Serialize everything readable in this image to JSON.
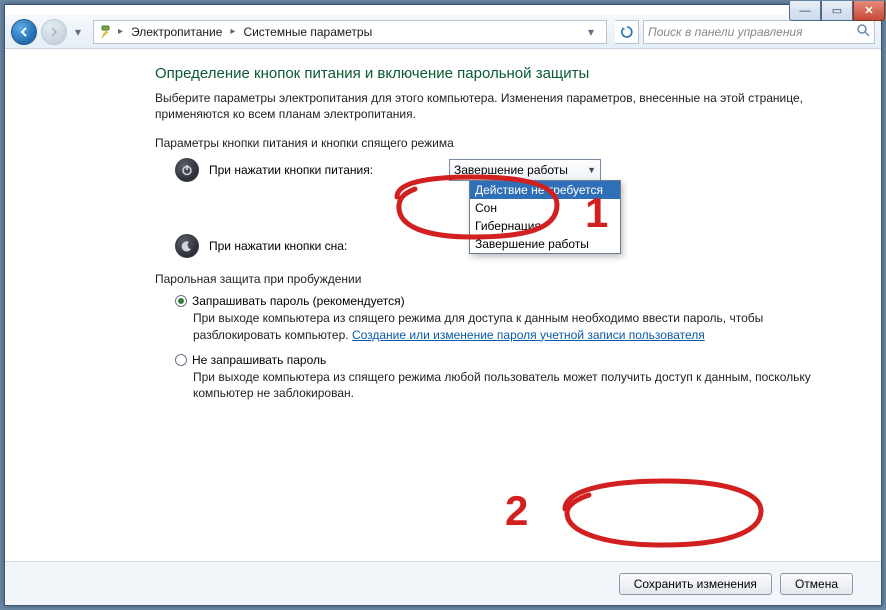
{
  "window": {
    "min_glyph": "—",
    "max_glyph": "▭",
    "close_glyph": "✕"
  },
  "nav": {
    "breadcrumb": {
      "seg1": "Электропитание",
      "seg2": "Системные параметры"
    },
    "search_placeholder": "Поиск в панели управления"
  },
  "page": {
    "heading": "Определение кнопок питания и включение парольной защиты",
    "intro": "Выберите параметры электропитания для этого компьютера. Изменения параметров, внесенные на этой странице, применяются ко всем планам электропитания.",
    "section1": "Параметры кнопки питания и кнопки спящего режима",
    "row_power_label": "При нажатии кнопки питания:",
    "row_sleep_label": "При нажатии кнопки сна:",
    "combo_value": "Завершение работы",
    "combo_options": {
      "o1": "Действие не требуется",
      "o2": "Сон",
      "o3": "Гибернация",
      "o4": "Завершение работы"
    },
    "section2": "Парольная защита при пробуждении",
    "radio1_label": "Запрашивать пароль (рекомендуется)",
    "radio1_desc_a": "При выходе компьютера из спящего режима для доступа к данным необходимо ввести пароль, чтобы разблокировать компьютер. ",
    "radio1_link": "Создание или изменение пароля учетной записи пользователя",
    "radio2_label": "Не запрашивать пароль",
    "radio2_desc": "При выходе компьютера из спящего режима любой пользователь может получить доступ к данным, поскольку компьютер не заблокирован.",
    "btn_save": "Сохранить изменения",
    "btn_cancel": "Отмена"
  },
  "annotations": {
    "num1": "1",
    "num2": "2"
  }
}
